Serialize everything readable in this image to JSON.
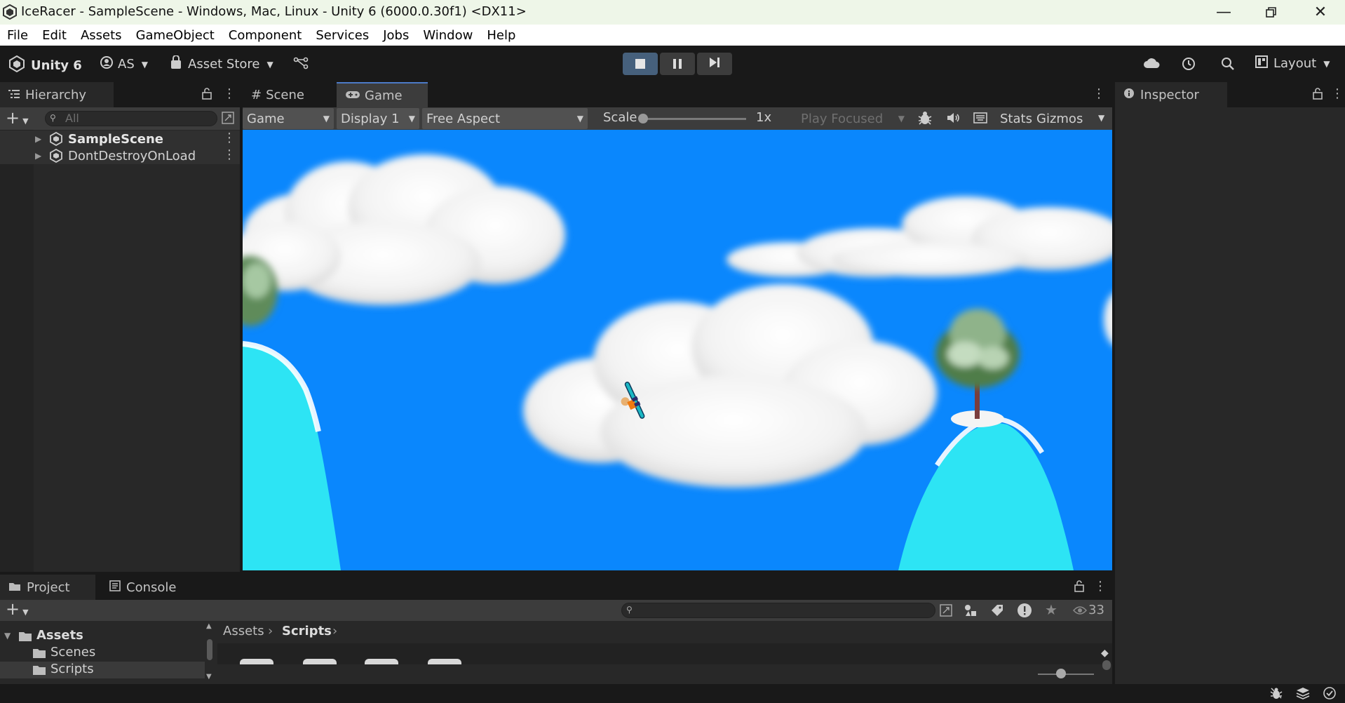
{
  "window": {
    "title": "IceRacer - SampleScene - Windows, Mac, Linux - Unity 6 (6000.0.30f1) <DX11>"
  },
  "menu": [
    "File",
    "Edit",
    "Assets",
    "GameObject",
    "Component",
    "Services",
    "Jobs",
    "Window",
    "Help"
  ],
  "toolbar": {
    "unity_label": "Unity 6",
    "account_label": "AS",
    "asset_store_label": "Asset Store",
    "layout_label": "Layout"
  },
  "hierarchy": {
    "tab_label": "Hierarchy",
    "search_placeholder": "All",
    "items": [
      {
        "label": "SampleScene"
      },
      {
        "label": "DontDestroyOnLoad"
      }
    ]
  },
  "center": {
    "tabs": [
      {
        "label": "Scene"
      },
      {
        "label": "Game"
      }
    ],
    "game_toolbar": {
      "mode": "Game",
      "display": "Display 1",
      "aspect": "Free Aspect",
      "scale_label": "Scale",
      "scale_value": "1x",
      "play_mode": "Play Focused",
      "stats_label": "Stats",
      "gizmos_label": "Gizmos"
    }
  },
  "inspector": {
    "tab_label": "Inspector"
  },
  "project": {
    "tabs": [
      {
        "label": "Project"
      },
      {
        "label": "Console"
      }
    ],
    "visible_count": "33",
    "tree": [
      {
        "label": "Assets"
      },
      {
        "label": "Scenes"
      },
      {
        "label": "Scripts"
      }
    ],
    "breadcrumb": [
      "Assets",
      "Scripts"
    ]
  },
  "colors": {
    "sky": "#0a87fd",
    "snow": "#2de4f4",
    "accent": "#4c7bc7"
  }
}
